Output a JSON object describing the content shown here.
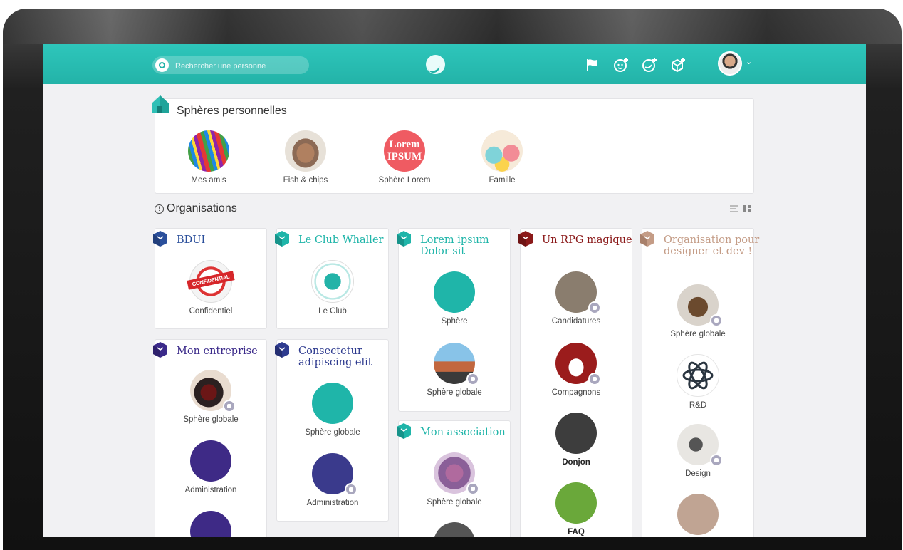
{
  "search": {
    "placeholder": "Rechercher une personne"
  },
  "topbar_icons": [
    "flag-icon",
    "add-person-icon",
    "add-sphere-icon",
    "add-org-icon"
  ],
  "personal": {
    "title": "Sphères personnelles",
    "spheres": [
      {
        "label": "Mes amis"
      },
      {
        "label": "Fish & chips"
      },
      {
        "label": "Sphère Lorem",
        "image_text": "Lorem IPSUM"
      },
      {
        "label": "Famille"
      }
    ]
  },
  "organisations": {
    "title": "Organisations",
    "orgs": [
      {
        "name": "BDUI",
        "color": "#2b4f9b",
        "spheres": [
          "Confidentiel"
        ],
        "seal_text": "CONFIDENTIAL"
      },
      {
        "name": "Le Club Whaller",
        "color": "#1fb5a9",
        "spheres": [
          "Le Club"
        ]
      },
      {
        "name": "Lorem ipsum Dolor sit",
        "color": "#1fb5a9",
        "spheres": [
          "Sphère",
          "Sphère globale"
        ]
      },
      {
        "name": "Un RPG magique",
        "color": "#8b1a1a",
        "spheres": [
          "Candidatures",
          "Compagnons",
          "Donjon",
          "FAQ"
        ]
      },
      {
        "name": "Organisation pour designer et dev !",
        "color": "#c49c86",
        "spheres": [
          "Sphère globale",
          "R&D",
          "Design"
        ]
      },
      {
        "name": "Mon entreprise",
        "color": "#3b2a8a",
        "spheres": [
          "Sphère globale",
          "Administration"
        ]
      },
      {
        "name": "Consectetur adipiscing elit",
        "color": "#2e3b8f",
        "spheres": [
          "Sphère globale",
          "Administration"
        ]
      },
      {
        "name": "Mon association",
        "color": "#1fb5a9",
        "spheres": [
          "Sphère globale"
        ]
      }
    ]
  }
}
